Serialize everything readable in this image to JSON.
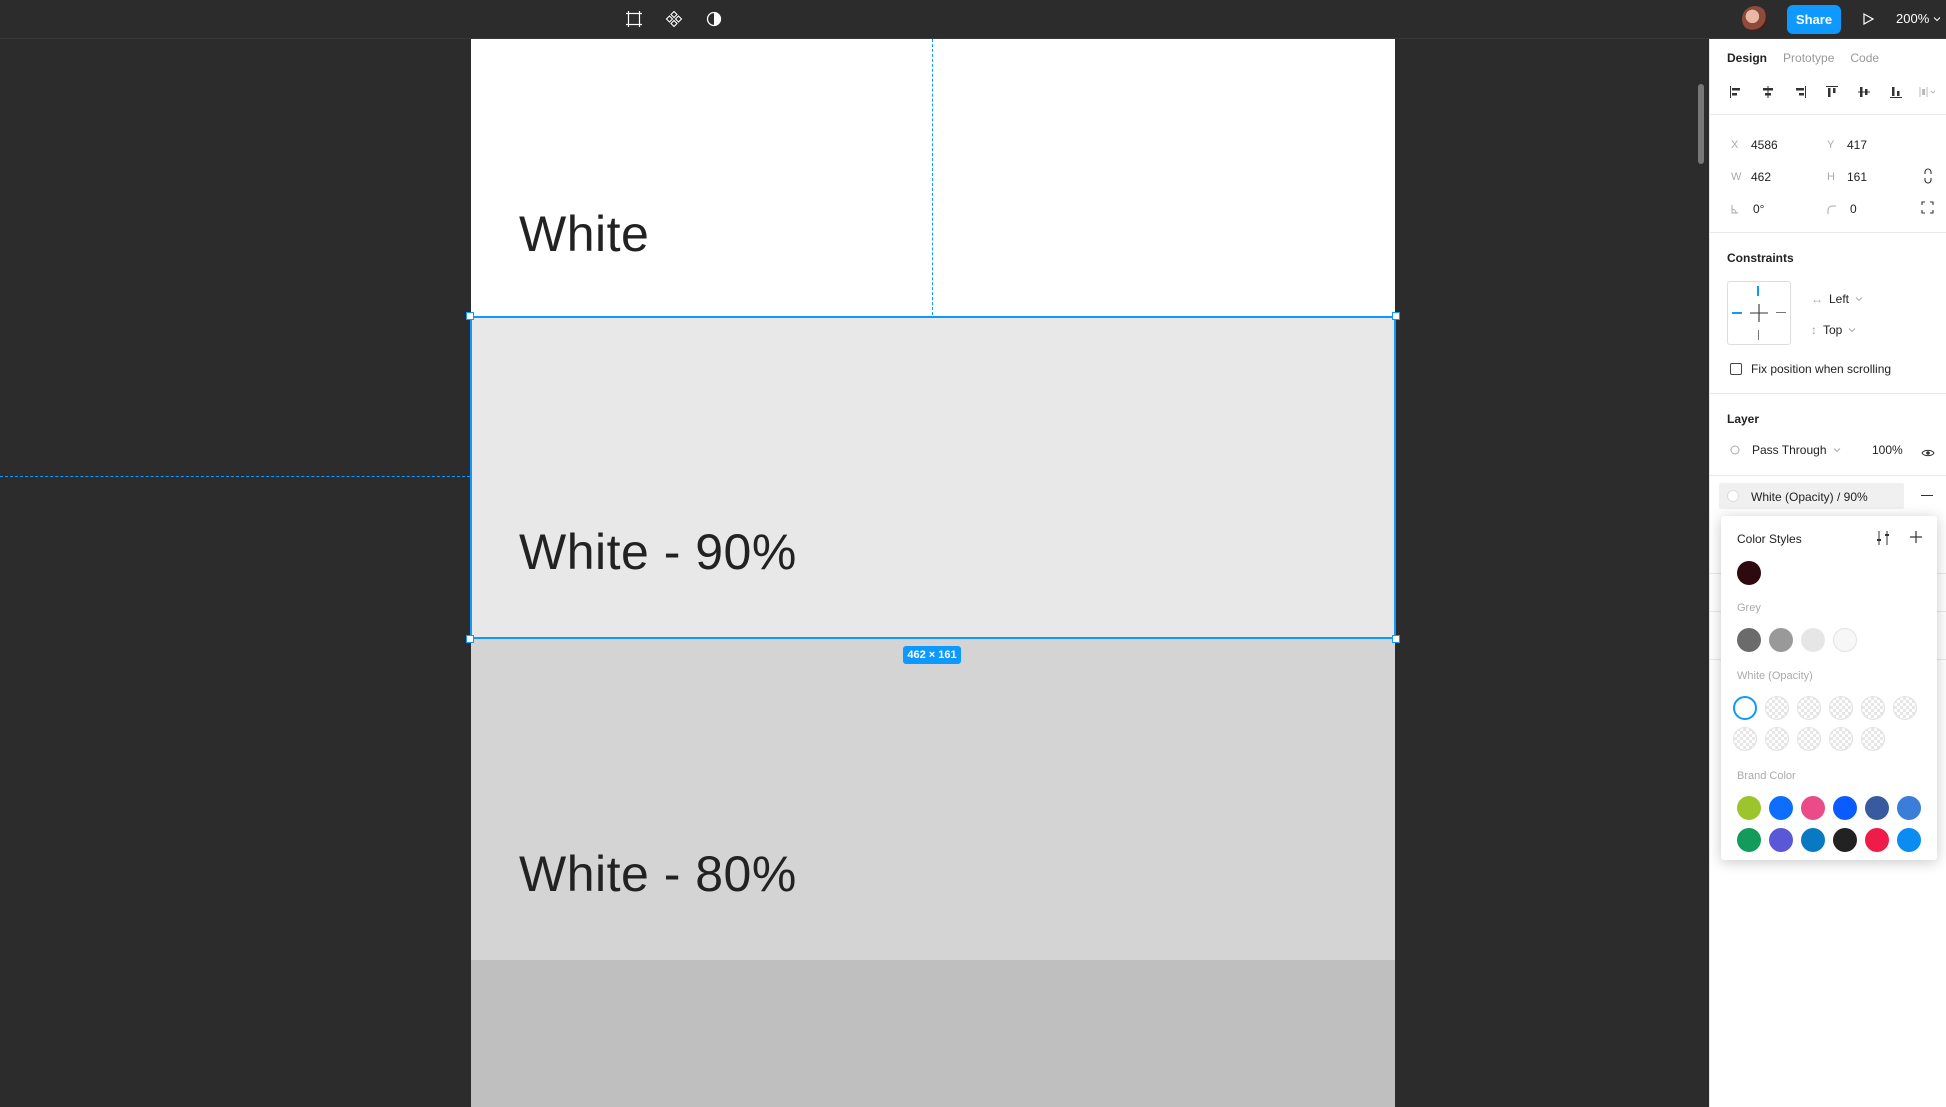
{
  "toolbar": {
    "tools": [
      "frame-icon",
      "component-icon",
      "contrast-icon"
    ],
    "share_label": "Share",
    "zoom_label": "200%"
  },
  "canvas": {
    "swatches": [
      {
        "label": "White",
        "color": "#ffffff"
      },
      {
        "label": "White - 90%",
        "color": "#e8e8e8"
      },
      {
        "label": "White - 80%",
        "color": "#d4d4d4"
      },
      {
        "label": "",
        "color": "#bfbfbf"
      }
    ],
    "selection_size": "462 × 161"
  },
  "panel": {
    "tabs": [
      "Design",
      "Prototype",
      "Code"
    ],
    "x_key": "X",
    "x": "4586",
    "y_key": "Y",
    "y": "417",
    "w_key": "W",
    "w": "462",
    "h_key": "H",
    "h": "161",
    "rotation": "0°",
    "radius": "0",
    "constraints_title": "Constraints",
    "constraint_h": "Left",
    "constraint_v": "Top",
    "fix_position_label": "Fix position when scrolling",
    "layer_title": "Layer",
    "blend_mode": "Pass Through",
    "opacity": "100%",
    "fill_style": "White (Opacity) / 90%"
  },
  "color_styles": {
    "title": "Color Styles",
    "top": [
      "#2d0a0e"
    ],
    "grey_label": "Grey",
    "grey": [
      "#6b6b6b",
      "#999999",
      "#e6e6e6",
      "#f7f7f7"
    ],
    "white_opacity_label": "White (Opacity)",
    "brand_label": "Brand Color",
    "brand_row1": [
      "#9cc52d",
      "#0d6efd",
      "#ea4c89",
      "#0a5cff",
      "#3a5aa0",
      "#3b7dd8"
    ],
    "brand_row2": [
      "#139b5b",
      "#5a58d6",
      "#0a79c4",
      "#222222",
      "#ee1c47",
      "#0a8cf0"
    ]
  }
}
